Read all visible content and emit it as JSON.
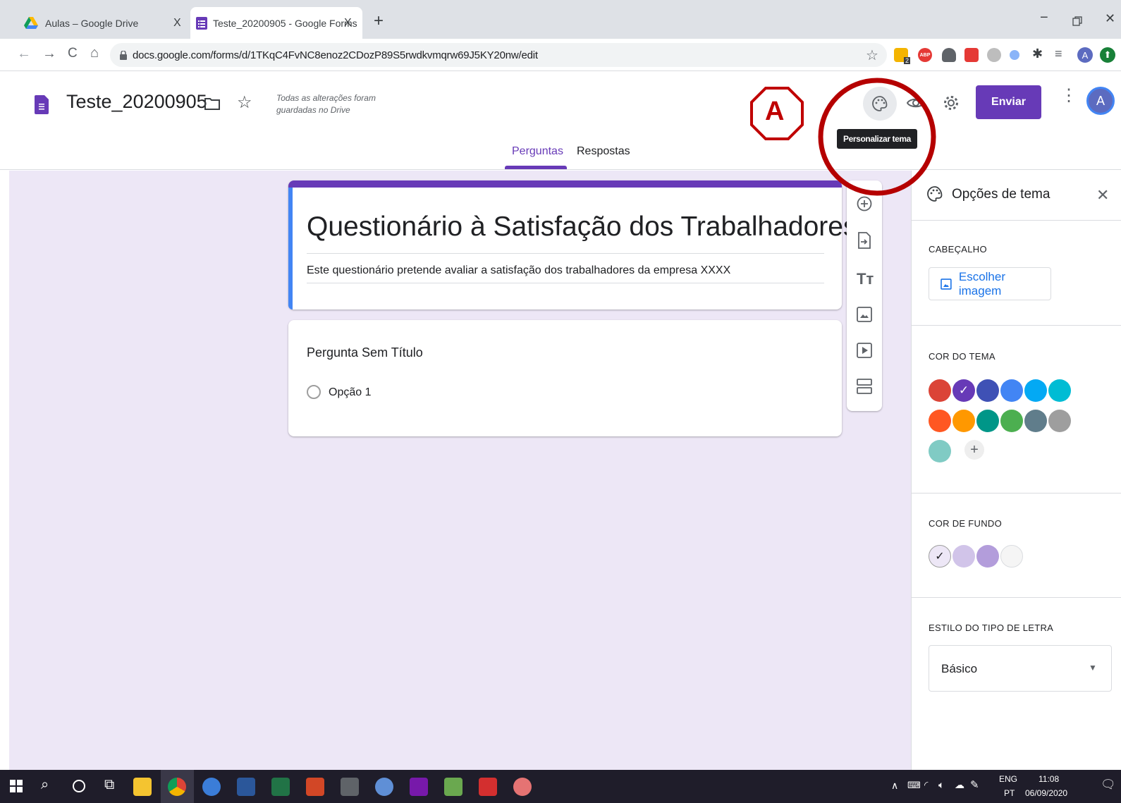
{
  "browser": {
    "tabs": [
      {
        "title": "Aulas – Google Drive",
        "close": "X"
      },
      {
        "title": "Teste_20200905 - Google Forms",
        "close": "X"
      }
    ],
    "new_tab": "+",
    "url": "docs.google.com/forms/d/1TKqC4FvNC8enoz2CDozP89S5rwdkvmqrw69J5KY20nw/edit",
    "profile_initial": "A",
    "extension_badge": "2",
    "adblock_label": "ABP"
  },
  "header": {
    "doc_title": "Teste_20200905",
    "save_status": "Todas as alterações foram guardadas no Drive",
    "send_label": "Enviar",
    "avatar_initial": "A",
    "tooltip": "Personalizar tema",
    "annotation_label": "A",
    "tabs": [
      "Perguntas",
      "Respostas"
    ],
    "active_tab": "Perguntas"
  },
  "form": {
    "title": "Questionário à Satisfação dos Trabalhadores",
    "description": "Este questionário pretende avaliar a satisfação dos trabalhadores da empresa XXXX",
    "question": {
      "title": "Pergunta Sem Título",
      "options": [
        "Opção 1"
      ]
    }
  },
  "side_toolbar": [
    "add-question",
    "import-questions",
    "add-title",
    "add-image",
    "add-video",
    "add-section"
  ],
  "theme_panel": {
    "title": "Opções de tema",
    "header_section": "CABEÇALHO",
    "choose_image": "Escolher imagem",
    "theme_color_section": "COR DO TEMA",
    "theme_colors": [
      "#db4437",
      "#673ab7",
      "#3f51b5",
      "#4285f4",
      "#03a9f4",
      "#00bcd4",
      "#ff5722",
      "#ff9800",
      "#009688",
      "#4caf50",
      "#607d8b",
      "#9e9e9e",
      "#80cbc4"
    ],
    "theme_color_selected": "#673ab7",
    "background_section": "COR DE FUNDO",
    "background_colors": [
      "#ede7f6",
      "#d1c4e9",
      "#b39ddb",
      "#f5f5f5"
    ],
    "background_selected": "#ede7f6",
    "font_section": "ESTILO DO TIPO DE LETRA",
    "font_value": "Básico"
  },
  "taskbar": {
    "lang_top": "ENG",
    "lang_bottom": "PT",
    "time": "11:08",
    "date": "06/09/2020"
  }
}
